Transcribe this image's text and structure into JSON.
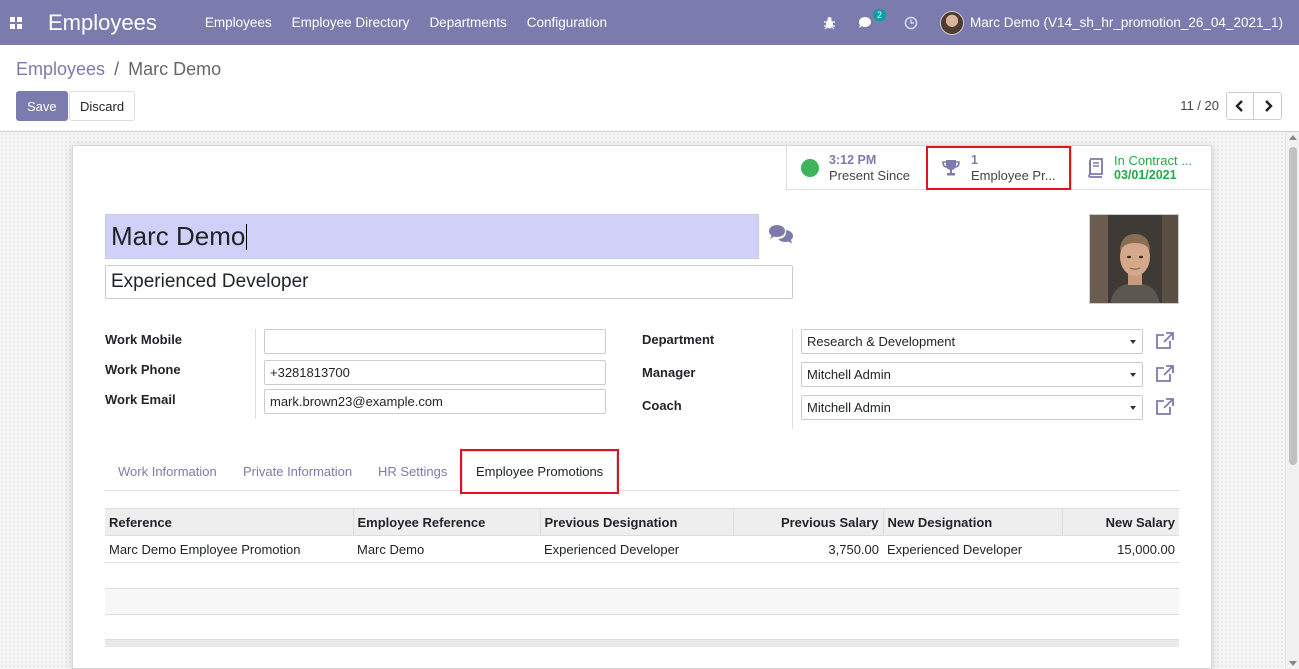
{
  "navbar": {
    "app_title": "Employees",
    "menu": [
      "Employees",
      "Employee Directory",
      "Departments",
      "Configuration"
    ],
    "chat_badge": "2",
    "user": "Marc Demo (V14_sh_hr_promotion_26_04_2021_1)"
  },
  "breadcrumb": {
    "parent": "Employees",
    "separator": "/",
    "current": "Marc Demo"
  },
  "actions": {
    "save": "Save",
    "discard": "Discard"
  },
  "pager": {
    "value": "11 / 20",
    "prev": "‹",
    "next": "›"
  },
  "smart_buttons": {
    "presence": {
      "value": "3:12 PM",
      "label": "Present Since"
    },
    "promotion": {
      "value": "1",
      "label": "Employee Pr..."
    },
    "contract": {
      "label": "In Contract ...",
      "value": "03/01/2021"
    }
  },
  "employee": {
    "name": "Marc Demo",
    "job_title": "Experienced Developer"
  },
  "fields_left": {
    "work_mobile_label": "Work Mobile",
    "work_mobile": "",
    "work_phone_label": "Work Phone",
    "work_phone": "+3281813700",
    "work_email_label": "Work Email",
    "work_email": "mark.brown23@example.com"
  },
  "fields_right": {
    "department_label": "Department",
    "department": "Research & Development",
    "manager_label": "Manager",
    "manager": "Mitchell Admin",
    "coach_label": "Coach",
    "coach": "Mitchell Admin"
  },
  "tabs": [
    "Work Information",
    "Private Information",
    "HR Settings",
    "Employee Promotions"
  ],
  "promotions_table": {
    "headers": [
      "Reference",
      "Employee Reference",
      "Previous Designation",
      "Previous Salary",
      "New Designation",
      "New Salary"
    ],
    "rows": [
      [
        "Marc Demo Employee Promotion",
        "Marc Demo",
        "Experienced Developer",
        "3,750.00",
        "Experienced Developer",
        "15,000.00"
      ]
    ]
  },
  "colors": {
    "brand": "#7c7bad",
    "highlight": "#e0141e",
    "presence": "#3fb35a",
    "contract": "#28a745"
  }
}
